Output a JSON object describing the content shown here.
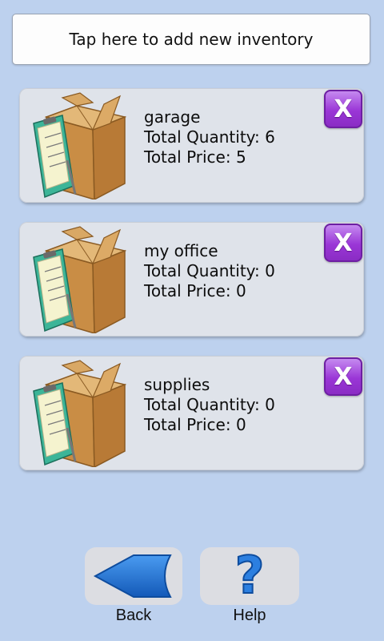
{
  "header": {
    "add_label": "Tap here to add new inventory"
  },
  "inventories": [
    {
      "name": "garage",
      "quantity_line": "Total Quantity: 6",
      "price_line": "Total Price: 5",
      "delete_label": "X"
    },
    {
      "name": "my office",
      "quantity_line": "Total Quantity: 0",
      "price_line": "Total Price: 0",
      "delete_label": "X"
    },
    {
      "name": "supplies",
      "quantity_line": "Total Quantity: 0",
      "price_line": "Total Price: 0",
      "delete_label": "X"
    }
  ],
  "footer": {
    "back_label": "Back",
    "help_label": "Help",
    "help_glyph": "?"
  },
  "icons": {
    "inventory": "box-clipboard-icon",
    "delete": "close-icon",
    "back": "back-arrow-icon",
    "help": "question-mark-icon"
  },
  "colors": {
    "background": "#bdd1ee",
    "card": "#dfe3ea",
    "delete_button": "#9a36d6",
    "back_arrow": "#1e6fd0",
    "help_mark": "#2c7fe0"
  }
}
